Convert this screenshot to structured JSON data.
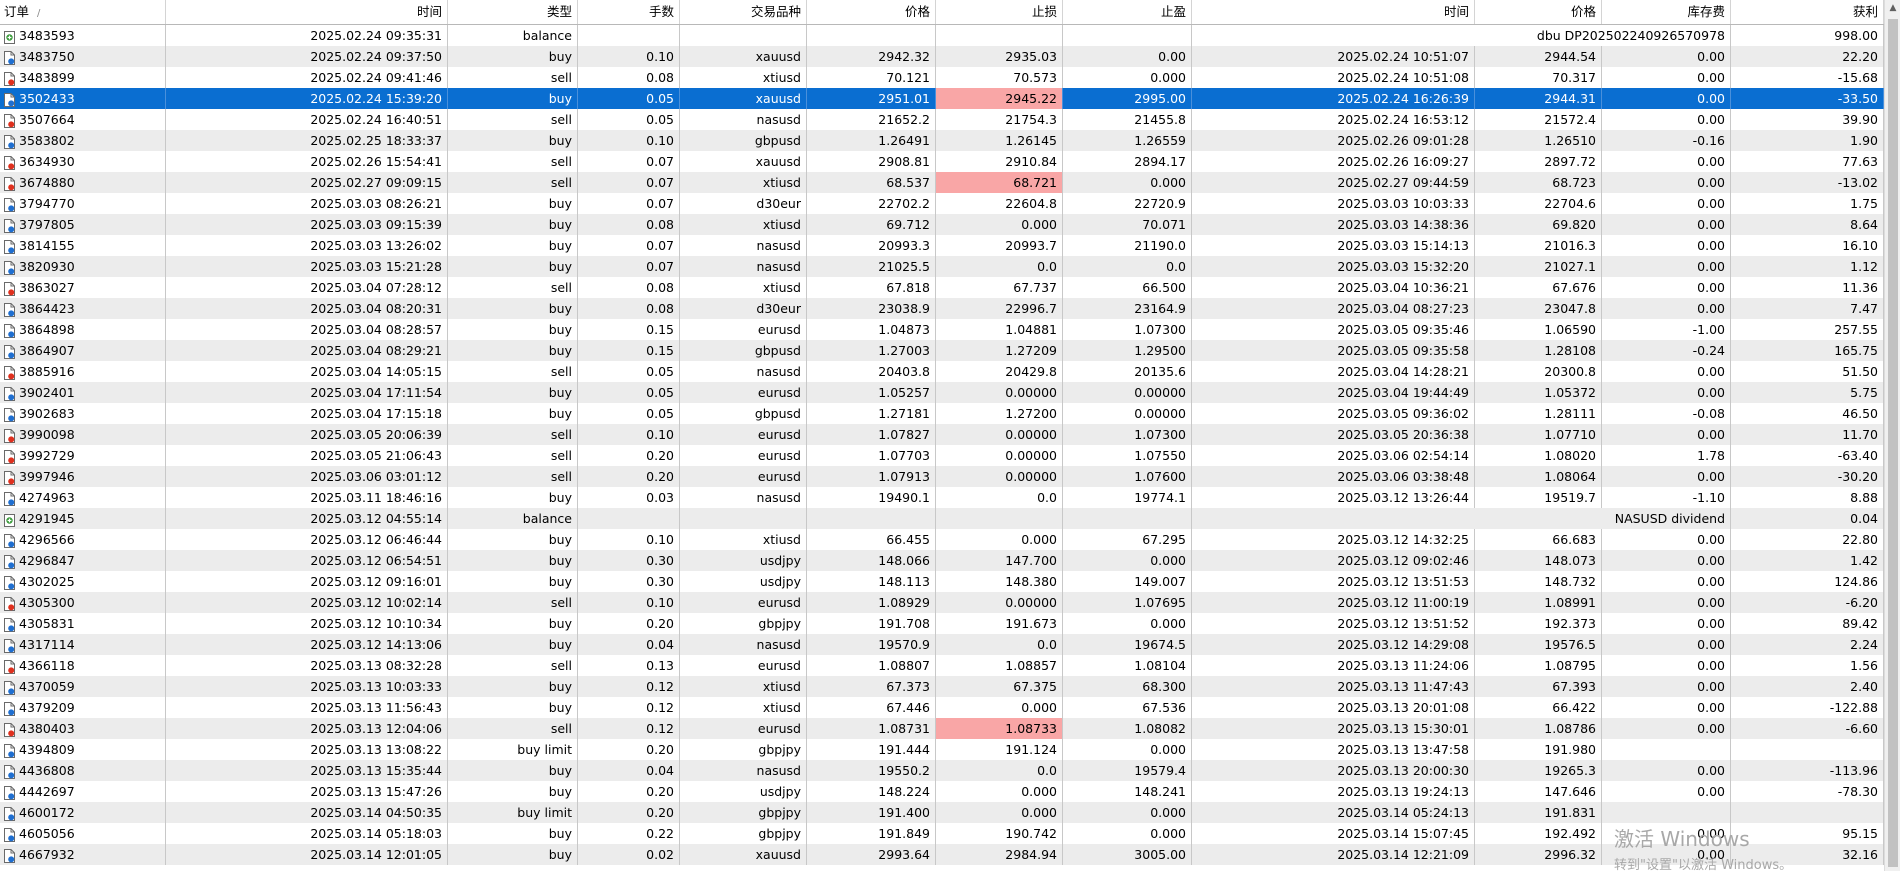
{
  "columns": [
    "订单",
    "时间",
    "类型",
    "手数",
    "交易品种",
    "价格",
    "止损",
    "止盈",
    "时间",
    "价格",
    "库存费",
    "获利"
  ],
  "sort_indicator": "/",
  "rows": [
    {
      "order": "3483593",
      "open_time": "2025.02.24 09:35:31",
      "type": "balance",
      "comment": "dbu DP202502240926570978",
      "profit": "998.00",
      "icon": "balance-icon"
    },
    {
      "order": "3483750",
      "open_time": "2025.02.24 09:37:50",
      "type": "buy",
      "lots": "0.10",
      "symbol": "xauusd",
      "price": "2942.32",
      "sl": "2935.03",
      "tp": "0.00",
      "close_time": "2025.02.24 10:51:07",
      "close_price": "2944.54",
      "swap": "0.00",
      "profit": "22.20",
      "icon": "buy-document-icon"
    },
    {
      "order": "3483899",
      "open_time": "2025.02.24 09:41:46",
      "type": "sell",
      "lots": "0.08",
      "symbol": "xtiusd",
      "price": "70.121",
      "sl": "70.573",
      "tp": "0.000",
      "close_time": "2025.02.24 10:51:08",
      "close_price": "70.317",
      "swap": "0.00",
      "profit": "-15.68",
      "icon": "sell-document-icon"
    },
    {
      "order": "3502433",
      "open_time": "2025.02.24 15:39:20",
      "type": "buy",
      "lots": "0.05",
      "symbol": "xauusd",
      "price": "2951.01",
      "sl": "2945.22",
      "tp": "2995.00",
      "close_time": "2025.02.24 16:26:39",
      "close_price": "2944.31",
      "swap": "0.00",
      "profit": "-33.50",
      "icon": "buy-document-icon",
      "selected": true,
      "sl_hit": true
    },
    {
      "order": "3507664",
      "open_time": "2025.02.24 16:40:51",
      "type": "sell",
      "lots": "0.05",
      "symbol": "nasusd",
      "price": "21652.2",
      "sl": "21754.3",
      "tp": "21455.8",
      "close_time": "2025.02.24 16:53:12",
      "close_price": "21572.4",
      "swap": "0.00",
      "profit": "39.90",
      "icon": "sell-document-icon"
    },
    {
      "order": "3583802",
      "open_time": "2025.02.25 18:33:37",
      "type": "buy",
      "lots": "0.10",
      "symbol": "gbpusd",
      "price": "1.26491",
      "sl": "1.26145",
      "tp": "1.26559",
      "close_time": "2025.02.26 09:01:28",
      "close_price": "1.26510",
      "swap": "-0.16",
      "profit": "1.90",
      "icon": "buy-document-icon"
    },
    {
      "order": "3634930",
      "open_time": "2025.02.26 15:54:41",
      "type": "sell",
      "lots": "0.07",
      "symbol": "xauusd",
      "price": "2908.81",
      "sl": "2910.84",
      "tp": "2894.17",
      "close_time": "2025.02.26 16:09:27",
      "close_price": "2897.72",
      "swap": "0.00",
      "profit": "77.63",
      "icon": "sell-document-icon"
    },
    {
      "order": "3674880",
      "open_time": "2025.02.27 09:09:15",
      "type": "sell",
      "lots": "0.07",
      "symbol": "xtiusd",
      "price": "68.537",
      "sl": "68.721",
      "tp": "0.000",
      "close_time": "2025.02.27 09:44:59",
      "close_price": "68.723",
      "swap": "0.00",
      "profit": "-13.02",
      "icon": "sell-document-icon",
      "sl_hit": true
    },
    {
      "order": "3794770",
      "open_time": "2025.03.03 08:26:21",
      "type": "buy",
      "lots": "0.07",
      "symbol": "d30eur",
      "price": "22702.2",
      "sl": "22604.8",
      "tp": "22720.9",
      "close_time": "2025.03.03 10:03:33",
      "close_price": "22704.6",
      "swap": "0.00",
      "profit": "1.75",
      "icon": "buy-document-icon"
    },
    {
      "order": "3797805",
      "open_time": "2025.03.03 09:15:39",
      "type": "buy",
      "lots": "0.08",
      "symbol": "xtiusd",
      "price": "69.712",
      "sl": "0.000",
      "tp": "70.071",
      "close_time": "2025.03.03 14:38:36",
      "close_price": "69.820",
      "swap": "0.00",
      "profit": "8.64",
      "icon": "buy-document-icon"
    },
    {
      "order": "3814155",
      "open_time": "2025.03.03 13:26:02",
      "type": "buy",
      "lots": "0.07",
      "symbol": "nasusd",
      "price": "20993.3",
      "sl": "20993.7",
      "tp": "21190.0",
      "close_time": "2025.03.03 15:14:13",
      "close_price": "21016.3",
      "swap": "0.00",
      "profit": "16.10",
      "icon": "buy-document-icon"
    },
    {
      "order": "3820930",
      "open_time": "2025.03.03 15:21:28",
      "type": "buy",
      "lots": "0.07",
      "symbol": "nasusd",
      "price": "21025.5",
      "sl": "0.0",
      "tp": "0.0",
      "close_time": "2025.03.03 15:32:20",
      "close_price": "21027.1",
      "swap": "0.00",
      "profit": "1.12",
      "icon": "buy-document-icon"
    },
    {
      "order": "3863027",
      "open_time": "2025.03.04 07:28:12",
      "type": "sell",
      "lots": "0.08",
      "symbol": "xtiusd",
      "price": "67.818",
      "sl": "67.737",
      "tp": "66.500",
      "close_time": "2025.03.04 10:36:21",
      "close_price": "67.676",
      "swap": "0.00",
      "profit": "11.36",
      "icon": "sell-document-icon"
    },
    {
      "order": "3864423",
      "open_time": "2025.03.04 08:20:31",
      "type": "buy",
      "lots": "0.08",
      "symbol": "d30eur",
      "price": "23038.9",
      "sl": "22996.7",
      "tp": "23164.9",
      "close_time": "2025.03.04 08:27:23",
      "close_price": "23047.8",
      "swap": "0.00",
      "profit": "7.47",
      "icon": "buy-document-icon"
    },
    {
      "order": "3864898",
      "open_time": "2025.03.04 08:28:57",
      "type": "buy",
      "lots": "0.15",
      "symbol": "eurusd",
      "price": "1.04873",
      "sl": "1.04881",
      "tp": "1.07300",
      "close_time": "2025.03.05 09:35:46",
      "close_price": "1.06590",
      "swap": "-1.00",
      "profit": "257.55",
      "icon": "buy-document-icon"
    },
    {
      "order": "3864907",
      "open_time": "2025.03.04 08:29:21",
      "type": "buy",
      "lots": "0.15",
      "symbol": "gbpusd",
      "price": "1.27003",
      "sl": "1.27209",
      "tp": "1.29500",
      "close_time": "2025.03.05 09:35:58",
      "close_price": "1.28108",
      "swap": "-0.24",
      "profit": "165.75",
      "icon": "buy-document-icon"
    },
    {
      "order": "3885916",
      "open_time": "2025.03.04 14:05:15",
      "type": "sell",
      "lots": "0.05",
      "symbol": "nasusd",
      "price": "20403.8",
      "sl": "20429.8",
      "tp": "20135.6",
      "close_time": "2025.03.04 14:28:21",
      "close_price": "20300.8",
      "swap": "0.00",
      "profit": "51.50",
      "icon": "sell-document-icon"
    },
    {
      "order": "3902401",
      "open_time": "2025.03.04 17:11:54",
      "type": "buy",
      "lots": "0.05",
      "symbol": "eurusd",
      "price": "1.05257",
      "sl": "0.00000",
      "tp": "0.00000",
      "close_time": "2025.03.04 19:44:49",
      "close_price": "1.05372",
      "swap": "0.00",
      "profit": "5.75",
      "icon": "buy-document-icon"
    },
    {
      "order": "3902683",
      "open_time": "2025.03.04 17:15:18",
      "type": "buy",
      "lots": "0.05",
      "symbol": "gbpusd",
      "price": "1.27181",
      "sl": "1.27200",
      "tp": "0.00000",
      "close_time": "2025.03.05 09:36:02",
      "close_price": "1.28111",
      "swap": "-0.08",
      "profit": "46.50",
      "icon": "buy-document-icon"
    },
    {
      "order": "3990098",
      "open_time": "2025.03.05 20:06:39",
      "type": "sell",
      "lots": "0.10",
      "symbol": "eurusd",
      "price": "1.07827",
      "sl": "0.00000",
      "tp": "1.07300",
      "close_time": "2025.03.05 20:36:38",
      "close_price": "1.07710",
      "swap": "0.00",
      "profit": "11.70",
      "icon": "sell-document-icon"
    },
    {
      "order": "3992729",
      "open_time": "2025.03.05 21:06:43",
      "type": "sell",
      "lots": "0.20",
      "symbol": "eurusd",
      "price": "1.07703",
      "sl": "0.00000",
      "tp": "1.07550",
      "close_time": "2025.03.06 02:54:14",
      "close_price": "1.08020",
      "swap": "1.78",
      "profit": "-63.40",
      "icon": "sell-document-icon"
    },
    {
      "order": "3997946",
      "open_time": "2025.03.06 03:01:12",
      "type": "sell",
      "lots": "0.20",
      "symbol": "eurusd",
      "price": "1.07913",
      "sl": "0.00000",
      "tp": "1.07600",
      "close_time": "2025.03.06 03:38:48",
      "close_price": "1.08064",
      "swap": "0.00",
      "profit": "-30.20",
      "icon": "sell-document-icon"
    },
    {
      "order": "4274963",
      "open_time": "2025.03.11 18:46:16",
      "type": "buy",
      "lots": "0.03",
      "symbol": "nasusd",
      "price": "19490.1",
      "sl": "0.0",
      "tp": "19774.1",
      "close_time": "2025.03.12 13:26:44",
      "close_price": "19519.7",
      "swap": "-1.10",
      "profit": "8.88",
      "icon": "buy-document-icon"
    },
    {
      "order": "4291945",
      "open_time": "2025.03.12 04:55:14",
      "type": "balance",
      "comment": "NASUSD dividend",
      "profit": "0.04",
      "icon": "balance-icon"
    },
    {
      "order": "4296566",
      "open_time": "2025.03.12 06:46:44",
      "type": "buy",
      "lots": "0.10",
      "symbol": "xtiusd",
      "price": "66.455",
      "sl": "0.000",
      "tp": "67.295",
      "close_time": "2025.03.12 14:32:25",
      "close_price": "66.683",
      "swap": "0.00",
      "profit": "22.80",
      "icon": "buy-document-icon"
    },
    {
      "order": "4296847",
      "open_time": "2025.03.12 06:54:51",
      "type": "buy",
      "lots": "0.30",
      "symbol": "usdjpy",
      "price": "148.066",
      "sl": "147.700",
      "tp": "0.000",
      "close_time": "2025.03.12 09:02:46",
      "close_price": "148.073",
      "swap": "0.00",
      "profit": "1.42",
      "icon": "buy-document-icon"
    },
    {
      "order": "4302025",
      "open_time": "2025.03.12 09:16:01",
      "type": "buy",
      "lots": "0.30",
      "symbol": "usdjpy",
      "price": "148.113",
      "sl": "148.380",
      "tp": "149.007",
      "close_time": "2025.03.12 13:51:53",
      "close_price": "148.732",
      "swap": "0.00",
      "profit": "124.86",
      "icon": "buy-document-icon"
    },
    {
      "order": "4305300",
      "open_time": "2025.03.12 10:02:14",
      "type": "sell",
      "lots": "0.10",
      "symbol": "eurusd",
      "price": "1.08929",
      "sl": "0.00000",
      "tp": "1.07695",
      "close_time": "2025.03.12 11:00:19",
      "close_price": "1.08991",
      "swap": "0.00",
      "profit": "-6.20",
      "icon": "sell-document-icon"
    },
    {
      "order": "4305831",
      "open_time": "2025.03.12 10:10:34",
      "type": "buy",
      "lots": "0.20",
      "symbol": "gbpjpy",
      "price": "191.708",
      "sl": "191.673",
      "tp": "0.000",
      "close_time": "2025.03.12 13:51:52",
      "close_price": "192.373",
      "swap": "0.00",
      "profit": "89.42",
      "icon": "buy-document-icon"
    },
    {
      "order": "4317114",
      "open_time": "2025.03.12 14:13:06",
      "type": "buy",
      "lots": "0.04",
      "symbol": "nasusd",
      "price": "19570.9",
      "sl": "0.0",
      "tp": "19674.5",
      "close_time": "2025.03.12 14:29:08",
      "close_price": "19576.5",
      "swap": "0.00",
      "profit": "2.24",
      "icon": "buy-document-icon"
    },
    {
      "order": "4366118",
      "open_time": "2025.03.13 08:32:28",
      "type": "sell",
      "lots": "0.13",
      "symbol": "eurusd",
      "price": "1.08807",
      "sl": "1.08857",
      "tp": "1.08104",
      "close_time": "2025.03.13 11:24:06",
      "close_price": "1.08795",
      "swap": "0.00",
      "profit": "1.56",
      "icon": "sell-document-icon"
    },
    {
      "order": "4370059",
      "open_time": "2025.03.13 10:03:33",
      "type": "buy",
      "lots": "0.12",
      "symbol": "xtiusd",
      "price": "67.373",
      "sl": "67.375",
      "tp": "68.300",
      "close_time": "2025.03.13 11:47:43",
      "close_price": "67.393",
      "swap": "0.00",
      "profit": "2.40",
      "icon": "buy-document-icon"
    },
    {
      "order": "4379209",
      "open_time": "2025.03.13 11:56:43",
      "type": "buy",
      "lots": "0.12",
      "symbol": "xtiusd",
      "price": "67.446",
      "sl": "0.000",
      "tp": "67.536",
      "close_time": "2025.03.13 20:01:08",
      "close_price": "66.422",
      "swap": "0.00",
      "profit": "-122.88",
      "icon": "buy-document-icon"
    },
    {
      "order": "4380403",
      "open_time": "2025.03.13 12:04:06",
      "type": "sell",
      "lots": "0.12",
      "symbol": "eurusd",
      "price": "1.08731",
      "sl": "1.08733",
      "tp": "1.08082",
      "close_time": "2025.03.13 15:30:01",
      "close_price": "1.08786",
      "swap": "0.00",
      "profit": "-6.60",
      "icon": "sell-document-icon",
      "sl_hit": true
    },
    {
      "order": "4394809",
      "open_time": "2025.03.13 13:08:22",
      "type": "buy limit",
      "lots": "0.20",
      "symbol": "gbpjpy",
      "price": "191.444",
      "sl": "191.124",
      "tp": "0.000",
      "close_time": "2025.03.13 13:47:58",
      "close_price": "191.980",
      "icon": "buy-document-icon"
    },
    {
      "order": "4436808",
      "open_time": "2025.03.13 15:35:44",
      "type": "buy",
      "lots": "0.04",
      "symbol": "nasusd",
      "price": "19550.2",
      "sl": "0.0",
      "tp": "19579.4",
      "close_time": "2025.03.13 20:00:30",
      "close_price": "19265.3",
      "swap": "0.00",
      "profit": "-113.96",
      "icon": "buy-document-icon"
    },
    {
      "order": "4442697",
      "open_time": "2025.03.13 15:47:26",
      "type": "buy",
      "lots": "0.20",
      "symbol": "usdjpy",
      "price": "148.224",
      "sl": "0.000",
      "tp": "148.241",
      "close_time": "2025.03.13 19:24:13",
      "close_price": "147.646",
      "swap": "0.00",
      "profit": "-78.30",
      "icon": "buy-document-icon"
    },
    {
      "order": "4600172",
      "open_time": "2025.03.14 04:50:35",
      "type": "buy limit",
      "lots": "0.20",
      "symbol": "gbpjpy",
      "price": "191.400",
      "sl": "0.000",
      "tp": "0.000",
      "close_time": "2025.03.14 05:24:13",
      "close_price": "191.831",
      "icon": "buy-document-icon"
    },
    {
      "order": "4605056",
      "open_time": "2025.03.14 05:18:03",
      "type": "buy",
      "lots": "0.22",
      "symbol": "gbpjpy",
      "price": "191.849",
      "sl": "190.742",
      "tp": "0.000",
      "close_time": "2025.03.14 15:07:45",
      "close_price": "192.492",
      "swap": "0.00",
      "profit": "95.15",
      "icon": "buy-document-icon"
    },
    {
      "order": "4667932",
      "open_time": "2025.03.14 12:01:05",
      "type": "buy",
      "lots": "0.02",
      "symbol": "xauusd",
      "price": "2993.64",
      "sl": "2984.94",
      "tp": "3005.00",
      "close_time": "2025.03.14 12:21:09",
      "close_price": "2996.32",
      "swap": "0.00",
      "profit": "32.16",
      "icon": "buy-document-icon"
    }
  ],
  "watermark": {
    "line1": "激活 Windows",
    "line2": "转到\"设置\"以激活 Windows。"
  },
  "colors": {
    "selected_row": "#0a6ed1",
    "stop_loss_hit": "#f9a6a6",
    "alt_row": "#ececec",
    "balance_icon": "#3a9a3a",
    "sell_icon_dot": "#e0301e",
    "buy_icon_dot": "#1f6fd1"
  }
}
